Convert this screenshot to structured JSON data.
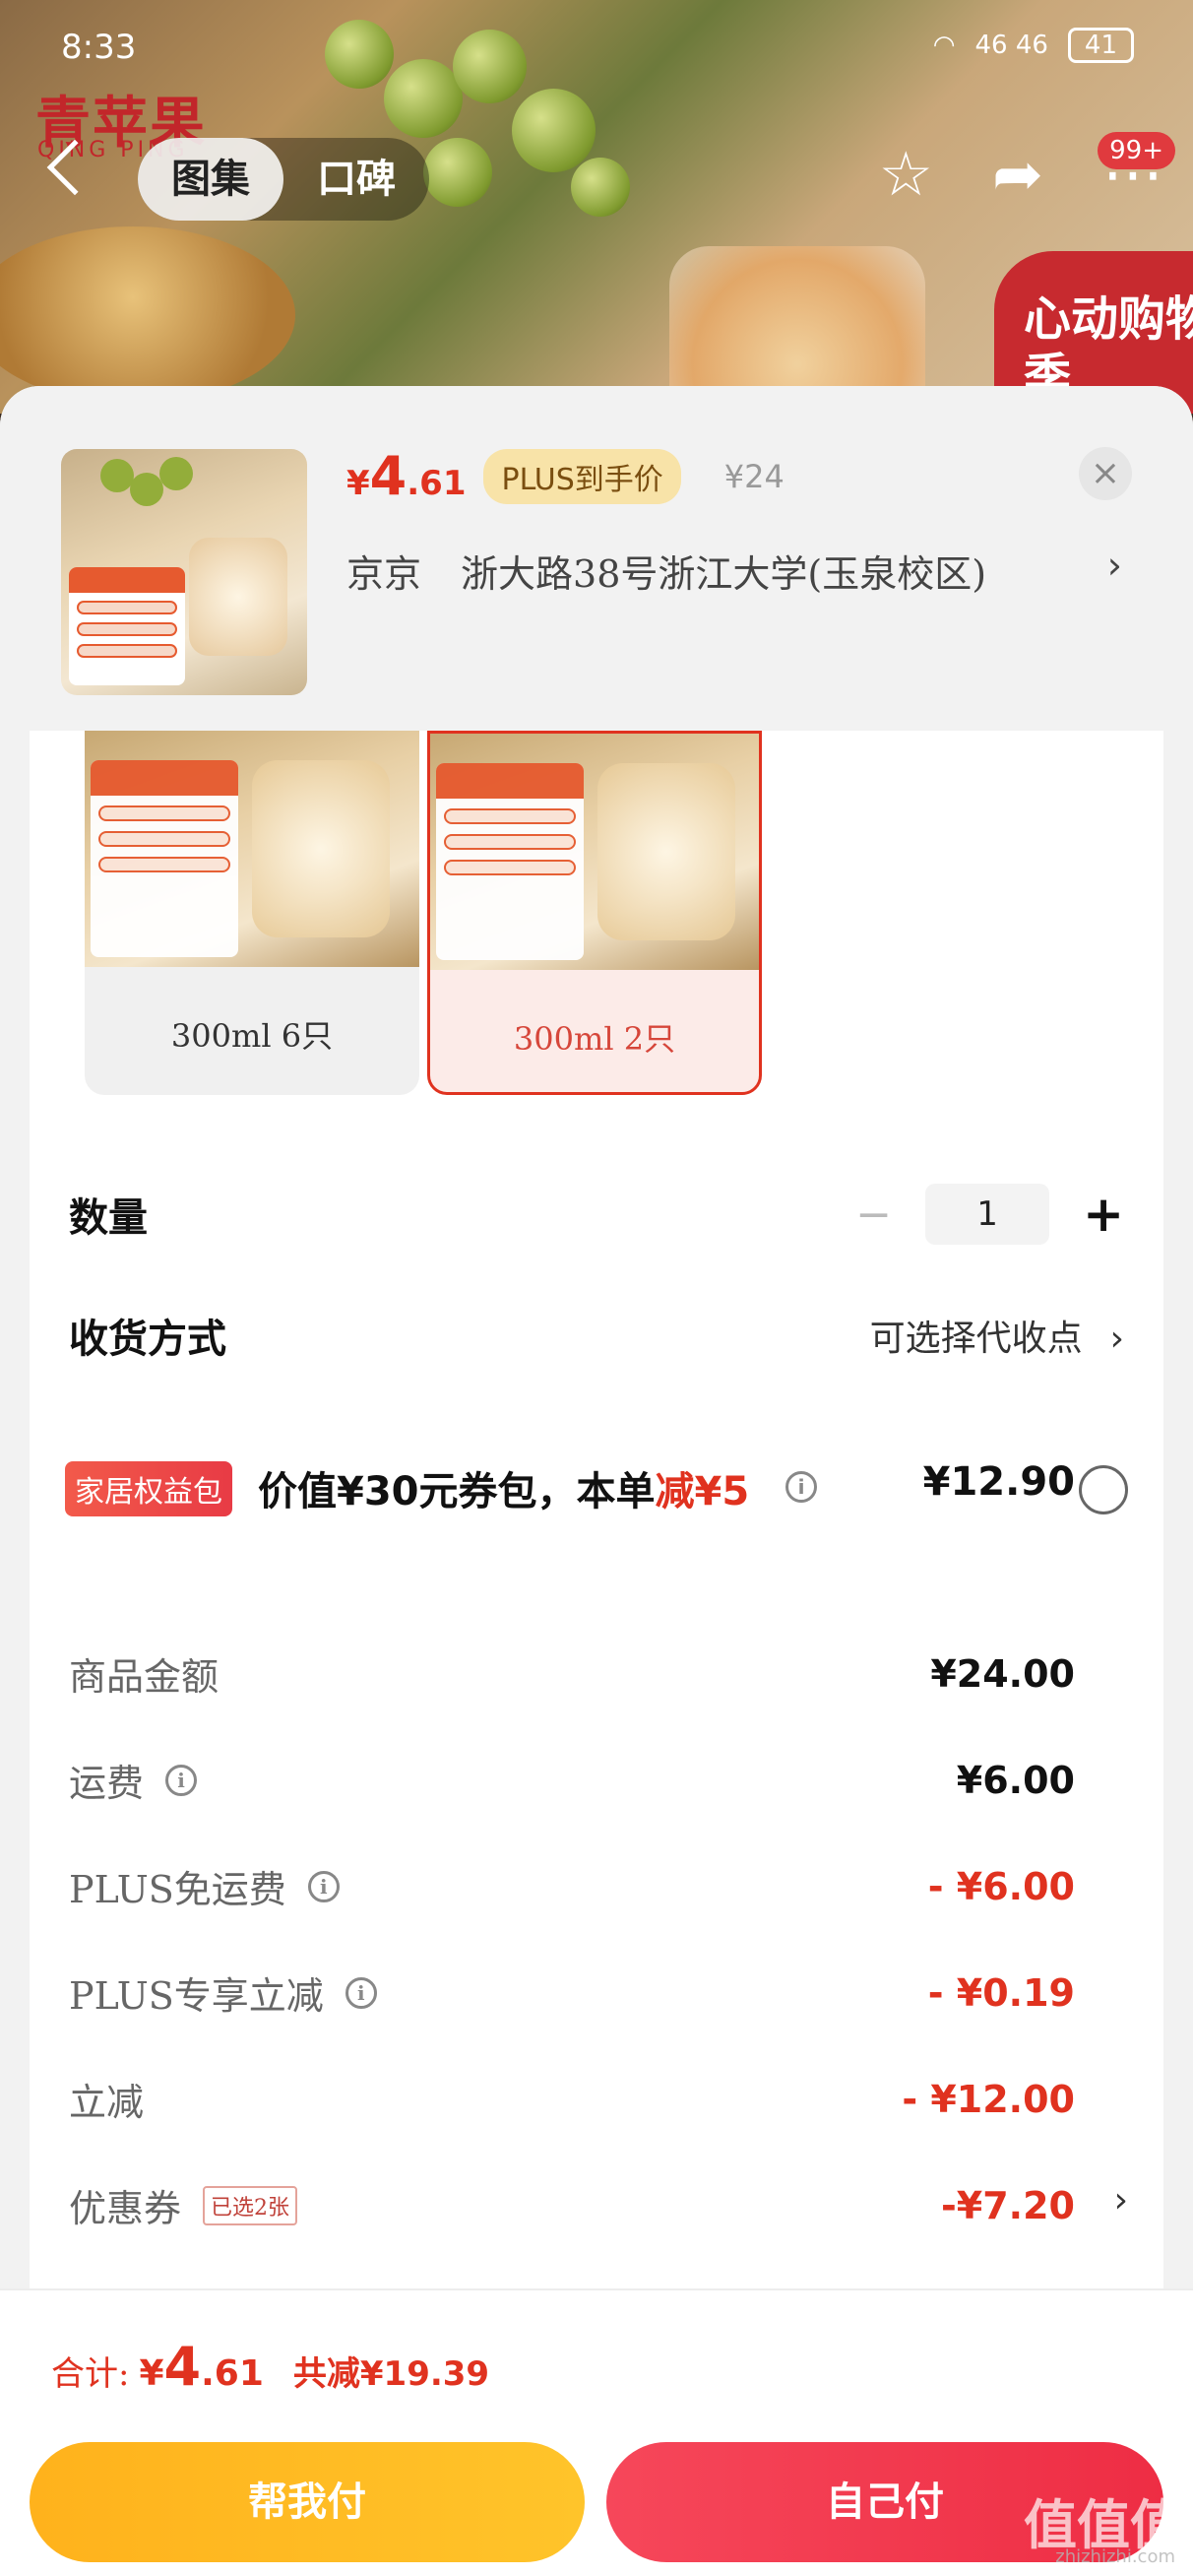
{
  "status_bar": {
    "time": "8:33",
    "signal_text": "46 46",
    "battery": "41"
  },
  "header": {
    "brand": "青苹果",
    "brand_sub": "QING PING",
    "tabs": [
      {
        "label": "图集",
        "active": true
      },
      {
        "label": "口碑",
        "active": false
      }
    ],
    "message_badge": "99+",
    "promo_badge": "心动购物季"
  },
  "summary": {
    "price_yen": "¥",
    "price_int": "4",
    "price_dec": ".61",
    "plus_tag": "PLUS到手价",
    "original_price": "¥24",
    "close_icon": "×",
    "recipient": "京京",
    "address": "浙大路38号浙江大学(玉泉校区)"
  },
  "variants": [
    {
      "label": "300ml  6只",
      "selected": false
    },
    {
      "label": "300ml  2只",
      "selected": true
    }
  ],
  "quantity": {
    "title": "数量",
    "minus": "−",
    "value": "1",
    "plus": "+"
  },
  "delivery": {
    "title": "收货方式",
    "value": "可选择代收点"
  },
  "benefit": {
    "tag": "家居权益包",
    "text_prefix": "价值¥30元券包，本单",
    "text_red": "减¥5",
    "price": "¥12.90"
  },
  "costs": {
    "goods_label": "商品金额",
    "goods_value": "¥24.00",
    "shipping_label": "运费",
    "shipping_value": "¥6.00",
    "plus_free_shipping_label": "PLUS免运费",
    "plus_free_shipping_value": "- ¥6.00",
    "plus_discount_label": "PLUS专享立减",
    "plus_discount_value": "- ¥0.19",
    "instant_discount_label": "立减",
    "instant_discount_value": "- ¥12.00",
    "coupon_label": "优惠券",
    "coupon_tag": "已选2张",
    "coupon_value": "-¥7.20"
  },
  "footer": {
    "total_label": "合计:",
    "total_yen": "¥",
    "total_int": "4",
    "total_dec": ".61",
    "saving": "共减¥19.39",
    "help_pay": "帮我付",
    "self_pay": "自己付"
  },
  "watermark": {
    "logo": "值值值",
    "site": "zhizhizhi.com"
  },
  "colors": {
    "accent_red": "#e0321f",
    "plus_gold": "#f8e3a8",
    "help_pay_yellow": "#ffb21c",
    "self_pay_red": "#f0354a"
  }
}
